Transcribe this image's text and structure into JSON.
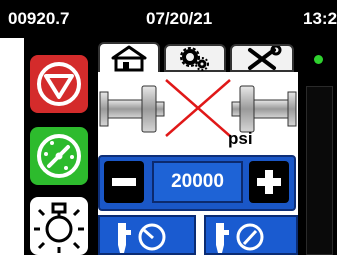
{
  "status": {
    "counter": "00920.7",
    "date": "07/20/21",
    "time": "13:2"
  },
  "icons": {
    "stop": "stop-icon",
    "gauge_active": "gauge-icon",
    "light": "lamp-icon",
    "home_tab": "home-icon",
    "settings_tab": "gears-icon",
    "tools_tab": "tools-icon",
    "cylinder": "cylinder-icon",
    "mode_a": "pressure-mode-icon",
    "mode_b": "pressure-mode-icon"
  },
  "main": {
    "unit": "psi",
    "pressure_value": "20000"
  },
  "colors": {
    "stop": "#d42b2b",
    "active": "#2dbb2d",
    "accent": "#1a5bd0",
    "alert": "#e01818",
    "indicator": "#2fd12f"
  }
}
